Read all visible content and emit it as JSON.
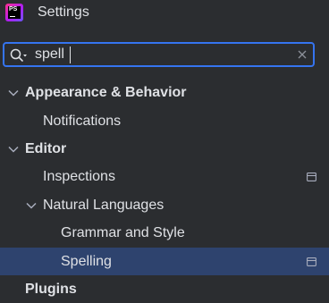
{
  "window": {
    "title": "Settings",
    "app_icon_text": "PS",
    "app_icon_name": "phpstorm-app-icon"
  },
  "search": {
    "value": "spell",
    "search_icon": "search-with-options-icon",
    "clear_icon": "close-icon"
  },
  "tree": {
    "items": [
      {
        "label": "Appearance & Behavior",
        "level": 0,
        "bold": true,
        "expanded": true,
        "icon": "chevron-down-icon"
      },
      {
        "label": "Notifications",
        "level": 1,
        "bold": false
      },
      {
        "label": "Editor",
        "level": 0,
        "bold": true,
        "expanded": true,
        "icon": "chevron-down-icon"
      },
      {
        "label": "Inspections",
        "level": 1,
        "bold": false,
        "trailing_icon": "project-settings-icon"
      },
      {
        "label": "Natural Languages",
        "level": 1,
        "bold": false,
        "expanded": true,
        "icon": "chevron-down-icon"
      },
      {
        "label": "Grammar and Style",
        "level": 2,
        "bold": false
      },
      {
        "label": "Spelling",
        "level": 2,
        "bold": false,
        "selected": true,
        "trailing_icon": "project-settings-icon"
      },
      {
        "label": "Plugins",
        "level": 0,
        "bold": true
      }
    ]
  },
  "colors": {
    "background": "#2b2d30",
    "text": "#dfe1e5",
    "focus_border": "#3574f0",
    "selection": "#2e436e",
    "icon": "#a8adbd"
  }
}
